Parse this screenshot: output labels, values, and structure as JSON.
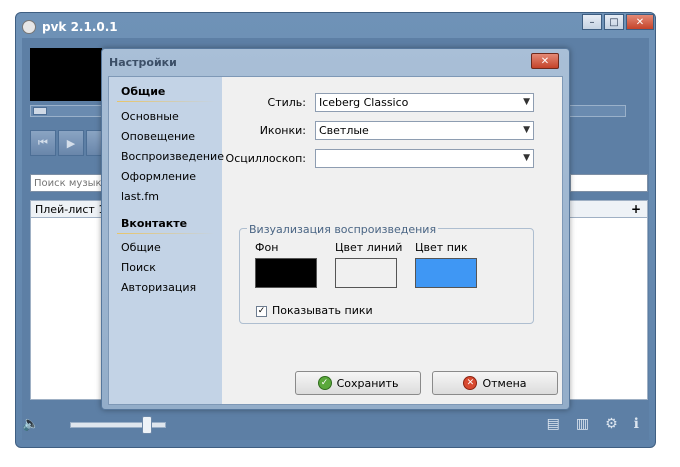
{
  "main_window": {
    "title": "pvk 2.1.0.1",
    "search_placeholder": "Поиск музыки",
    "playlist_tab": "Плей-лист 1",
    "add_tab": "+"
  },
  "dialog": {
    "title": "Настройки",
    "close_symbol": "✕",
    "sidebar": {
      "group1_header": "Общие",
      "group1_items": [
        "Основные",
        "Оповещение",
        "Воспроизведение",
        "Оформление",
        "last.fm"
      ],
      "group2_header": "Вконтакте",
      "group2_items": [
        "Общие",
        "Поиск",
        "Авторизация"
      ]
    },
    "style_label": "Стиль:",
    "style_value": "Iceberg Classico",
    "icons_label": "Иконки:",
    "icons_value": "Светлые",
    "osc_label": "Осциллоскоп:",
    "osc_value": "",
    "viz_group_title": "Визуализация воспроизведения",
    "bg_label": "Фон",
    "line_label": "Цвет линий",
    "peak_label": "Цвет пик",
    "colors": {
      "background": "#000000",
      "lines": "#f0f0f0",
      "peaks": "#3f97f4"
    },
    "show_peaks_label": "Показывать пики",
    "show_peaks_checked": true,
    "save_label": "Сохранить",
    "cancel_label": "Отмена"
  }
}
